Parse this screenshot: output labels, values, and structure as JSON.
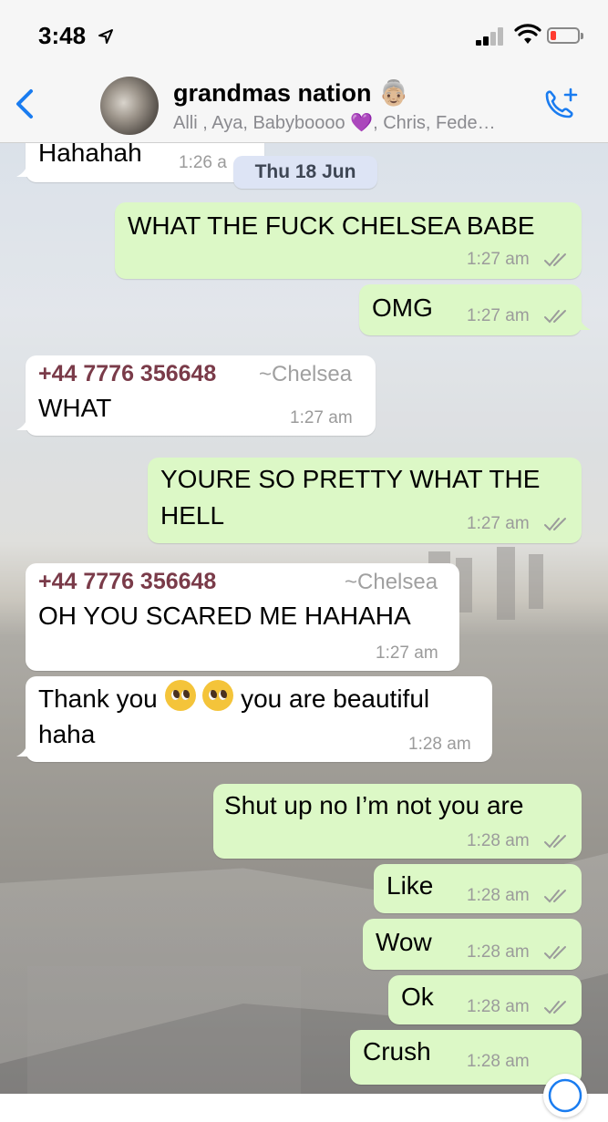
{
  "status_bar": {
    "time": "3:48",
    "location_icon": "location-arrow-icon",
    "battery_color": "#ff3b30"
  },
  "header": {
    "back_icon": "chevron-left-icon",
    "group_name": "grandmas nation 👵🏼",
    "members": "Alli , Aya, Babyboooo 💜, Chris, Fede…",
    "call_icon": "add-call-icon",
    "accent": "#1a7cf0"
  },
  "date_pill": "Thu 18 Jun",
  "messages": [
    {
      "direction": "in",
      "text": "Hahahah",
      "time": "1:26 a"
    },
    {
      "direction": "out",
      "text": "WHAT THE FUCK CHELSEA BABE",
      "time": "1:27 am"
    },
    {
      "direction": "out",
      "text": "OMG",
      "time": "1:27 am"
    },
    {
      "direction": "in",
      "sender_phone": "+44 7776 356648",
      "sender_name": "~Chelsea",
      "text": "WHAT",
      "time": "1:27 am"
    },
    {
      "direction": "out",
      "lines": [
        "YOURE SO PRETTY WHAT THE",
        "HELL"
      ],
      "time": "1:27 am"
    },
    {
      "direction": "in",
      "sender_phone": "+44 7776 356648",
      "sender_name": "~Chelsea",
      "text": "OH YOU SCARED ME HAHAHA",
      "time": "1:27 am"
    },
    {
      "direction": "in",
      "line1_before": "Thank you",
      "line1_after": "you are beautiful",
      "line2": "haha",
      "emoji": "pleading-face-icon",
      "time": "1:28 am"
    },
    {
      "direction": "out",
      "text": "Shut up no I’m not you are",
      "time": "1:28 am"
    },
    {
      "direction": "out",
      "text": "Like",
      "time": "1:28 am"
    },
    {
      "direction": "out",
      "text": "Wow",
      "time": "1:28 am"
    },
    {
      "direction": "out",
      "text": "Ok",
      "time": "1:28 am"
    },
    {
      "direction": "out",
      "text": "Crush",
      "time": "1:28 am"
    }
  ],
  "scroll_button_icon": "scroll-down-icon"
}
